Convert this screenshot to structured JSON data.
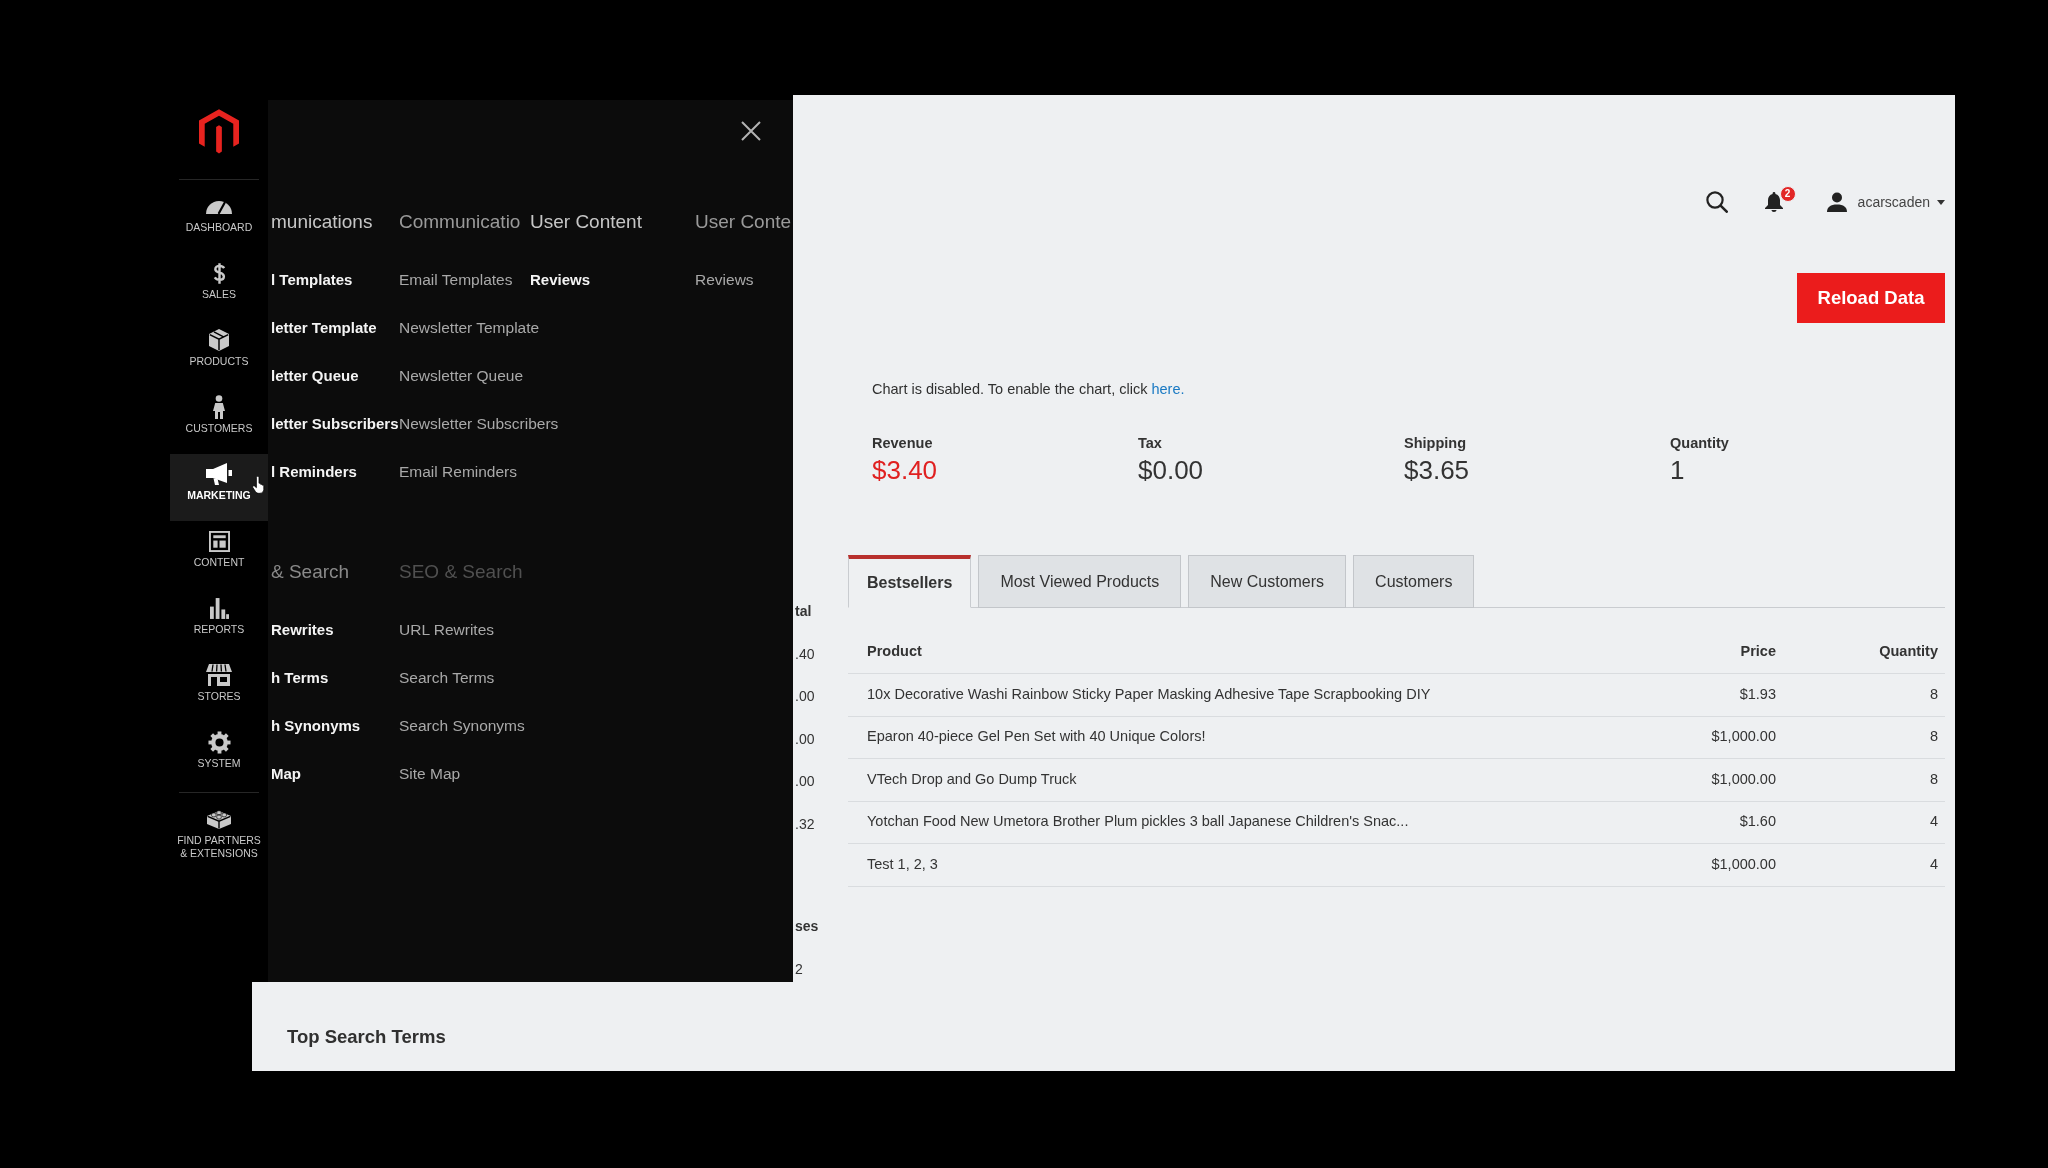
{
  "sidebar": {
    "items": [
      {
        "label": "DASHBOARD",
        "selected": false
      },
      {
        "label": "SALES",
        "selected": false
      },
      {
        "label": "PRODUCTS",
        "selected": false
      },
      {
        "label": "CUSTOMERS",
        "selected": false
      },
      {
        "label": "MARKETING",
        "selected": true
      },
      {
        "label": "CONTENT",
        "selected": false
      },
      {
        "label": "REPORTS",
        "selected": false
      },
      {
        "label": "STORES",
        "selected": false
      },
      {
        "label": "SYSTEM",
        "selected": false
      },
      {
        "label": "FIND PARTNERS & EXTENSIONS",
        "selected": false
      }
    ]
  },
  "menu_panel": {
    "sections": [
      {
        "dimmed": false,
        "columns": [
          {
            "kind": "sharp",
            "heading": "munications",
            "items": [
              "l Templates",
              "letter Template",
              "letter Queue",
              "letter Subscribers",
              "l Reminders"
            ]
          },
          {
            "kind": "faded",
            "heading": "Communicatio",
            "items": [
              "Email Templates",
              "Newsletter Template",
              "Newsletter Queue",
              "Newsletter Subscribers",
              "Email Reminders"
            ]
          },
          {
            "kind": "sharp",
            "heading": "User Content",
            "items": [
              "Reviews"
            ]
          },
          {
            "kind": "faded",
            "heading": "User Conte",
            "items": [
              "Reviews"
            ]
          }
        ]
      },
      {
        "dimmed": true,
        "columns": [
          {
            "kind": "sharp",
            "heading": "& Search",
            "items": [
              "Rewrites",
              "h Terms",
              "h Synonyms",
              "Map"
            ]
          },
          {
            "kind": "faded",
            "heading": "SEO & Search",
            "items": [
              "URL Rewrites",
              "Search Terms",
              "Search Synonyms",
              "Site Map"
            ]
          }
        ]
      }
    ]
  },
  "covered_columns": [
    {
      "header": "tal",
      "cells": [
        ".40",
        ".00",
        ".00",
        ".00",
        ".32"
      ]
    },
    {
      "header": "ses",
      "cells": [
        "2"
      ]
    }
  ],
  "top_bar": {
    "notification_count": "2",
    "user_name": "acarscaden"
  },
  "reload_button": {
    "label": "Reload Data"
  },
  "chart_notice": {
    "text": "Chart is disabled. To enable the chart, click ",
    "link": "here."
  },
  "stats": [
    {
      "label": "Revenue",
      "value": "$3.40",
      "highlighted": true
    },
    {
      "label": "Tax",
      "value": "$0.00",
      "highlighted": false
    },
    {
      "label": "Shipping",
      "value": "$3.65",
      "highlighted": false
    },
    {
      "label": "Quantity",
      "value": "1",
      "highlighted": false
    }
  ],
  "tabs": [
    {
      "label": "Bestsellers",
      "selected": true
    },
    {
      "label": "Most Viewed Products",
      "selected": false
    },
    {
      "label": "New Customers",
      "selected": false
    },
    {
      "label": "Customers",
      "selected": false
    }
  ],
  "table": {
    "columns": [
      "Product",
      "Price",
      "Quantity"
    ],
    "rows": [
      [
        "10x Decorative Washi Rainbow Sticky Paper Masking Adhesive Tape Scrapbooking DIY",
        "$1.93",
        "8"
      ],
      [
        "Eparon 40-piece Gel Pen Set with 40 Unique Colors!",
        "$1,000.00",
        "8"
      ],
      [
        "VTech Drop and Go Dump Truck",
        "$1,000.00",
        "8"
      ],
      [
        "Yotchan Food New Umetora Brother Plum pickles 3 ball Japanese Children's Snac...",
        "$1.60",
        "4"
      ],
      [
        "Test 1, 2, 3",
        "$1,000.00",
        "4"
      ]
    ]
  },
  "bottom_panel": {
    "title": "Top Search Terms"
  }
}
